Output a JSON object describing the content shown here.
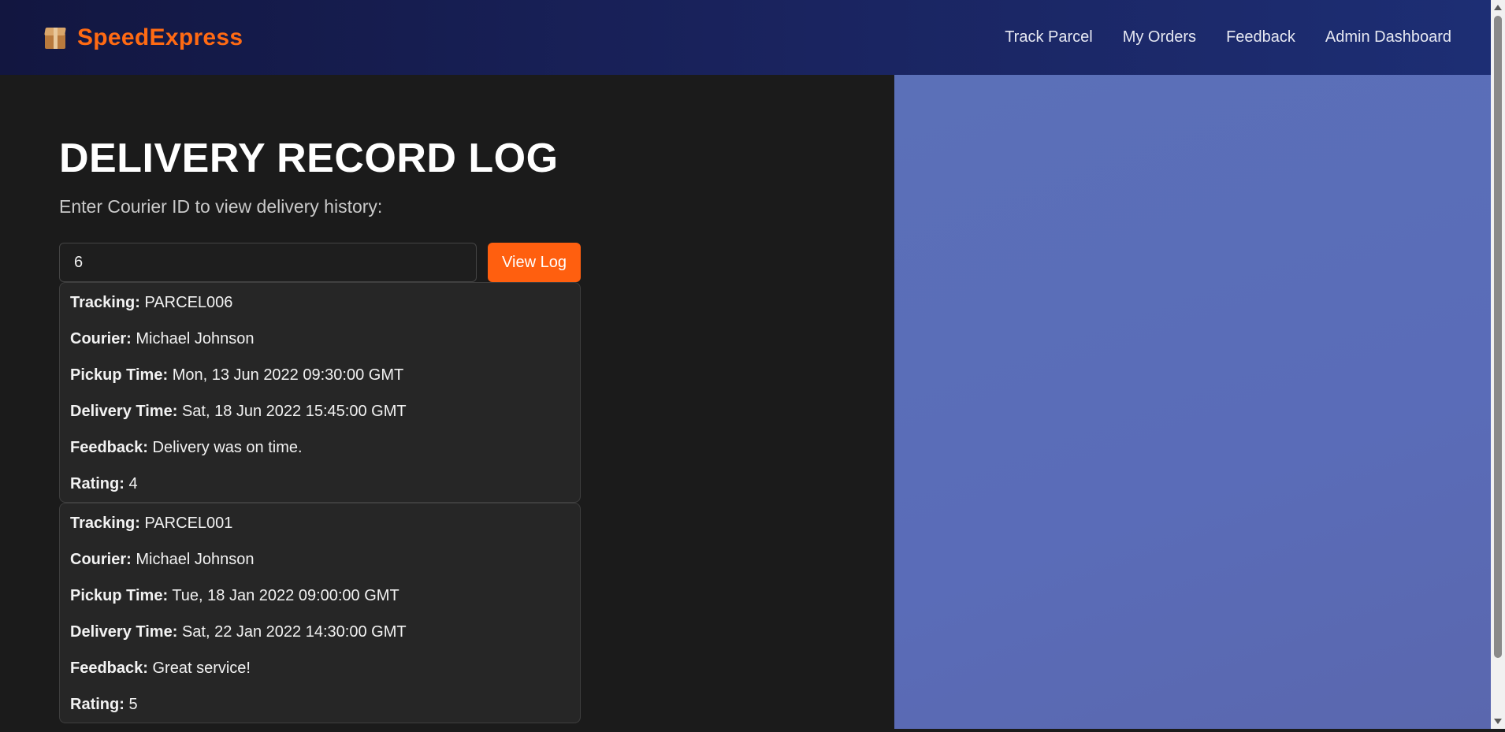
{
  "header": {
    "brand_name": "SpeedExpress",
    "brand_icon": "package-icon",
    "nav": [
      "Track Parcel",
      "My Orders",
      "Feedback",
      "Admin Dashboard"
    ]
  },
  "main": {
    "title": "DELIVERY RECORD LOG",
    "subtitle": "Enter Courier ID to view delivery history:",
    "courier_input_value": "6",
    "view_log_label": "View Log",
    "field_labels": {
      "tracking": "Tracking:",
      "courier": "Courier:",
      "pickup": "Pickup Time:",
      "delivery": "Delivery Time:",
      "feedback": "Feedback:",
      "rating": "Rating:"
    },
    "records": [
      {
        "tracking": "PARCEL006",
        "courier": "Michael Johnson",
        "pickup": "Mon, 13 Jun 2022 09:30:00 GMT",
        "delivery": "Sat, 18 Jun 2022 15:45:00 GMT",
        "feedback": "Delivery was on time.",
        "rating": "4"
      },
      {
        "tracking": "PARCEL001",
        "courier": "Michael Johnson",
        "pickup": "Tue, 18 Jan 2022 09:00:00 GMT",
        "delivery": "Sat, 22 Jan 2022 14:30:00 GMT",
        "feedback": "Great service!",
        "rating": "5"
      }
    ]
  },
  "colors": {
    "accent": "#ff5f0f",
    "brand": "#ff6a13",
    "navbar": "#1a2460",
    "right_panel": "#5a6cb8"
  }
}
